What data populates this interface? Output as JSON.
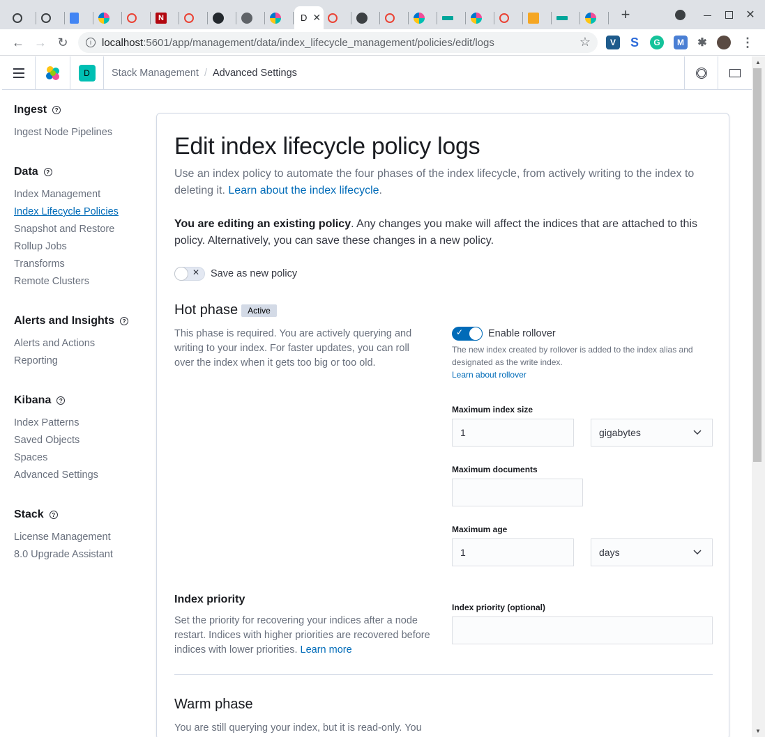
{
  "browser": {
    "active_tab_label": "D",
    "url_host": "localhost",
    "url_path": ":5601/app/management/data/index_lifecycle_management/policies/edit/logs",
    "new_tab_label": "+"
  },
  "kibana_header": {
    "space_avatar": "D",
    "breadcrumbs": [
      "Stack Management",
      "Advanced Settings"
    ]
  },
  "sidebar": {
    "groups": [
      {
        "title": "Ingest",
        "items": [
          "Ingest Node Pipelines"
        ]
      },
      {
        "title": "Data",
        "items": [
          "Index Management",
          "Index Lifecycle Policies",
          "Snapshot and Restore",
          "Rollup Jobs",
          "Transforms",
          "Remote Clusters"
        ]
      },
      {
        "title": "Alerts and Insights",
        "items": [
          "Alerts and Actions",
          "Reporting"
        ]
      },
      {
        "title": "Kibana",
        "items": [
          "Index Patterns",
          "Saved Objects",
          "Spaces",
          "Advanced Settings"
        ]
      },
      {
        "title": "Stack",
        "items": [
          "License Management",
          "8.0 Upgrade Assistant"
        ]
      }
    ],
    "selected": "Index Lifecycle Policies"
  },
  "page": {
    "title": "Edit index lifecycle policy logs",
    "intro": "Use an index policy to automate the four phases of the index lifecycle, from actively writing to the index to deleting it.",
    "intro_link": "Learn about the index lifecycle",
    "intro_link_suffix": ".",
    "editing_bold": "You are editing an existing policy",
    "editing_rest": ". Any changes you make will affect the indices that are attached to this policy. Alternatively, you can save these changes in a new policy.",
    "save_as_new_label": "Save as new policy",
    "save_as_new_on": false
  },
  "hot_phase": {
    "title": "Hot phase",
    "badge": "Active",
    "description": "This phase is required. You are actively querying and writing to your index. For faster updates, you can roll over the index when it gets too big or too old.",
    "rollover_label": "Enable rollover",
    "rollover_on": true,
    "rollover_help": "The new index created by rollover is added to the index alias and designated as the write index.",
    "rollover_link": "Learn about rollover",
    "max_size_label": "Maximum index size",
    "max_size_value": "1",
    "max_size_unit": "gigabytes",
    "max_docs_label": "Maximum documents",
    "max_docs_value": "",
    "max_age_label": "Maximum age",
    "max_age_value": "1",
    "max_age_unit": "days"
  },
  "index_priority": {
    "title": "Index priority",
    "description": "Set the priority for recovering your indices after a node restart. Indices with higher priorities are recovered before indices with lower priorities.",
    "link": "Learn more",
    "field_label": "Index priority (optional)",
    "field_value": ""
  },
  "warm_phase": {
    "title": "Warm phase",
    "description": "You are still querying your index, but it is read-only. You"
  }
}
